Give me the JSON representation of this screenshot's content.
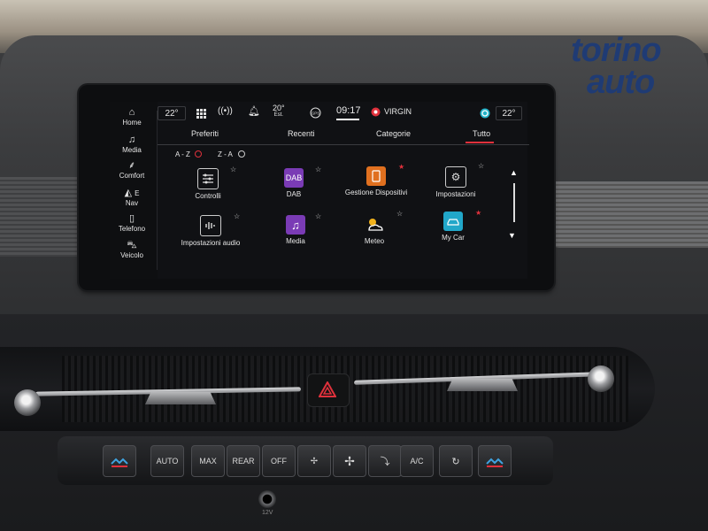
{
  "status_bar": {
    "temp_left": "22°",
    "temp_right": "22°",
    "external_temp": "20°",
    "external_label": "Est.",
    "clock": "09:17",
    "radio_station": "VIRGIN",
    "gps_icon_label": "GPS"
  },
  "nav_rail": [
    {
      "label": "Home",
      "icon": "home-icon"
    },
    {
      "label": "Media",
      "icon": "music-note-icon"
    },
    {
      "label": "Comfort",
      "icon": "seat-comfort-icon"
    },
    {
      "label": "Nav",
      "icon": "navigation-arrow-icon",
      "heading": "E"
    },
    {
      "label": "Telefono",
      "icon": "phone-icon"
    },
    {
      "label": "Veicolo",
      "icon": "car-icon"
    }
  ],
  "tabs": [
    {
      "label": "Preferiti"
    },
    {
      "label": "Recenti"
    },
    {
      "label": "Categorie"
    },
    {
      "label": "Tutto",
      "active": true
    }
  ],
  "sort": {
    "az_label": "A - Z",
    "za_label": "Z - A",
    "selected": "A - Z"
  },
  "apps": [
    {
      "label": "Controlli",
      "icon": "sliders-icon"
    },
    {
      "label": "DAB",
      "icon": "dab-radio-icon"
    },
    {
      "label": "Gestione Dispositivi",
      "icon": "device-manager-icon"
    },
    {
      "label": "Impostazioni",
      "icon": "gear-icon"
    },
    {
      "label": "Impostazioni audio",
      "icon": "audio-settings-icon"
    },
    {
      "label": "Media",
      "icon": "music-note-icon"
    },
    {
      "label": "Meteo",
      "icon": "weather-icon"
    },
    {
      "label": "My Car",
      "icon": "my-car-icon"
    }
  ],
  "climate_panel": {
    "auto_label": "AUTO",
    "max_label": "MAX",
    "rear_label": "REAR",
    "off_label": "OFF",
    "ac_label": "A/C",
    "usb_label": "12V"
  },
  "logo": {
    "line1": "torino",
    "line2": "auto"
  },
  "colors": {
    "accent_red": "#e0313c",
    "dab_purple": "#7a3bb5",
    "gestione_orange": "#e0701f",
    "mycar_cyan": "#21a7c9",
    "logo_blue": "#1f3b74"
  }
}
